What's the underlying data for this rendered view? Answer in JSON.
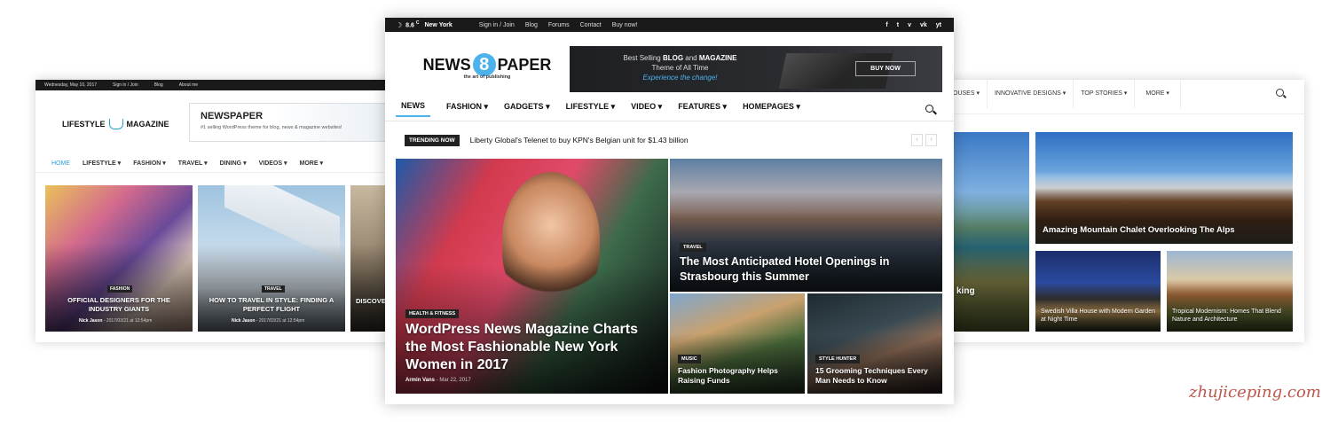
{
  "left": {
    "topbar": [
      "Wednesday, May 10, 2017",
      "Sign in / Join",
      "Blog",
      "About me"
    ],
    "logo": {
      "left": "LIFESTYLE",
      "right": "MAGAZINE"
    },
    "ad": {
      "title": "NEWSPAPER",
      "subtitle": "#1 selling WordPress theme for blog, news & magazine websites!"
    },
    "nav": [
      "HOME",
      "LIFESTYLE",
      "FASHION",
      "TRAVEL",
      "DINING",
      "VIDEOS",
      "MORE"
    ],
    "posts": [
      {
        "tag": "FASHION",
        "title": "OFFICIAL DESIGNERS FOR THE INDUSTRY GIANTS",
        "author": "Nick Jason",
        "date": "2017/03/21 at 12:54pm"
      },
      {
        "tag": "TRAVEL",
        "title": "HOW TO TRAVEL IN STYLE: FINDING A PERFECT FLIGHT",
        "author": "Nick Jason",
        "date": "2017/03/21 at 12:54pm"
      },
      {
        "title": "DISCOVE"
      }
    ]
  },
  "center": {
    "topbar": {
      "temp": "8.6",
      "unit": "C",
      "city": "New York",
      "links": [
        "Sign in / Join",
        "Blog",
        "Forums",
        "Contact",
        "Buy now!"
      ],
      "social": [
        "f",
        "t",
        "v",
        "vk",
        "yt"
      ]
    },
    "logo": {
      "left": "NEWS",
      "number": "8",
      "right": "PAPER",
      "tagline": "the art of publishing"
    },
    "banner": {
      "line1a": "Best Selling ",
      "line1b": "BLOG",
      "line1c": " and ",
      "line1d": "MAGAZINE",
      "line2": "Theme of All Time",
      "line3": "Experience the change!",
      "button": "BUY NOW"
    },
    "nav": [
      "NEWS",
      "FASHION",
      "GADGETS",
      "LIFESTYLE",
      "VIDEO",
      "FEATURES",
      "HOMEPAGES"
    ],
    "trending": {
      "label": "TRENDING NOW",
      "text": "Liberty Global's Telenet to buy KPN's Belgian unit for $1.43 billion"
    },
    "hero": {
      "tag": "HEALTH & FITNESS",
      "title": "WordPress News Magazine Charts the Most Fashionable New York Women in 2017",
      "author": "Armin Vans",
      "date": "Mar 22, 2017"
    },
    "top_right": {
      "tag": "TRAVEL",
      "title": "The Most Anticipated Hotel Openings in Strasbourg this Summer"
    },
    "small1": {
      "tag": "MUSIC",
      "title": "Fashion Photography Helps Raising Funds"
    },
    "small2": {
      "tag": "STYLE HUNTER",
      "title": "15 Grooming Techniques Every Man Needs to Know"
    }
  },
  "right": {
    "nav": [
      "OUSES",
      "INNOVATIVE DESIGNS",
      "TOP STORIES",
      "MORE"
    ],
    "partial": "king",
    "big": {
      "title": "Amazing Mountain Chalet Overlooking The Alps"
    },
    "s1": {
      "title": "Swedish Villa House with Modern Garden at Night Time"
    },
    "s2": {
      "title": "Tropical Modernism: Homes That Blend Nature and Architecture"
    }
  },
  "watermark": "zhujiceping.com"
}
